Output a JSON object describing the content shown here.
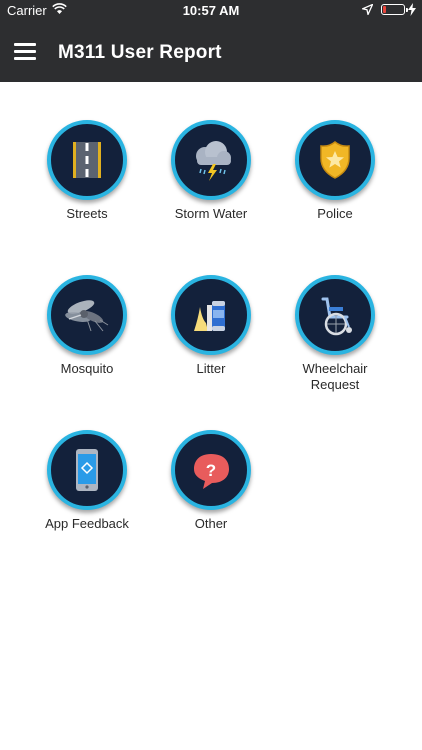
{
  "status_bar": {
    "carrier": "Carrier",
    "time": "10:57 AM"
  },
  "header": {
    "title": "M311 User Report",
    "menu_icon": "hamburger-menu-icon"
  },
  "categories": [
    {
      "label": "Streets",
      "icon": "road-icon"
    },
    {
      "label": "Storm Water",
      "icon": "storm-cloud-icon"
    },
    {
      "label": "Police",
      "icon": "police-badge-icon"
    },
    {
      "label": "Mosquito",
      "icon": "mosquito-icon"
    },
    {
      "label": "Litter",
      "icon": "litter-icon"
    },
    {
      "label": "Wheelchair\nRequest",
      "icon": "wheelchair-icon"
    },
    {
      "label": "App Feedback",
      "icon": "phone-icon"
    },
    {
      "label": "Other",
      "icon": "question-bubble-icon"
    }
  ],
  "colors": {
    "header_bg": "#2d2e30",
    "ring": "#2ab4e1",
    "circle_bg": "#13213b"
  }
}
